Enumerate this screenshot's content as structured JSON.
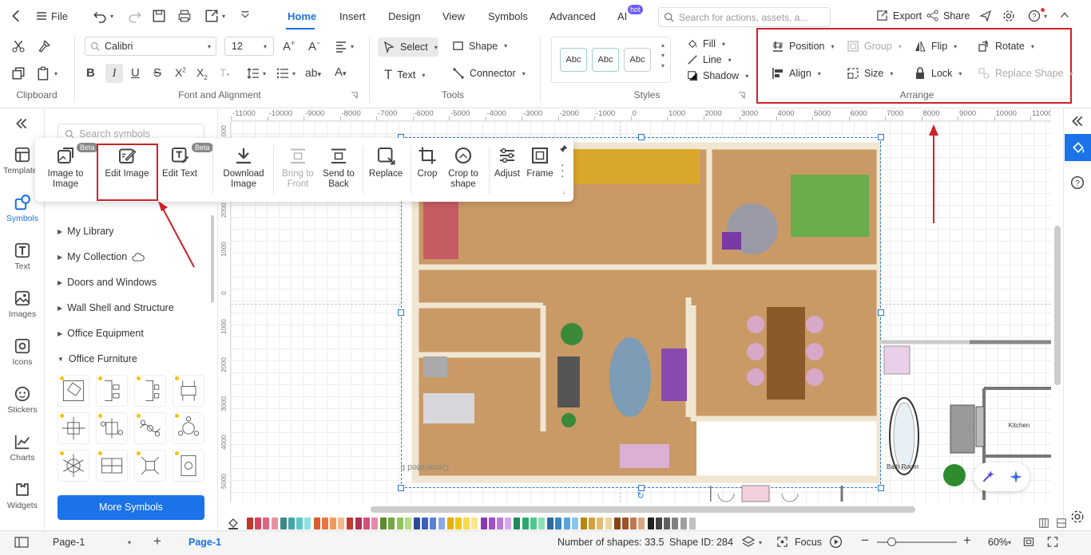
{
  "app": {
    "file_label": "File",
    "accent": "#1a73e8"
  },
  "menu_tabs": [
    "Home",
    "Insert",
    "Design",
    "View",
    "Symbols",
    "Advanced",
    "AI"
  ],
  "ai_badge": "hot",
  "search": {
    "placeholder": "Search for actions, assets, a..."
  },
  "header_actions": {
    "export": "Export",
    "share": "Share"
  },
  "ribbon": {
    "font_name": "Calibri",
    "font_size": "12",
    "select": "Select",
    "shape": "Shape",
    "text": "Text",
    "connector": "Connector",
    "style_sample": "Abc",
    "fill": "Fill",
    "line": "Line",
    "shadow": "Shadow",
    "position": "Position",
    "group": "Group",
    "flip": "Flip",
    "rotate": "Rotate",
    "align": "Align",
    "size": "Size",
    "lock": "Lock",
    "replace_shape": "Replace Shape",
    "sections": {
      "clipboard": "Clipboard",
      "font_alignment": "Font and Alignment",
      "tools": "Tools",
      "styles": "Styles",
      "arrange": "Arrange"
    }
  },
  "ruler_h": [
    "-11000",
    "-10000",
    "-9000",
    "-8000",
    "-7000",
    "-6000",
    "-5000",
    "-4000",
    "-3000",
    "-2000",
    "-1000",
    "0",
    "1000",
    "2000",
    "3000",
    "4000",
    "5000",
    "6000",
    "7000",
    "8000",
    "9000",
    "10000",
    "11000"
  ],
  "ruler_v": [
    "1000",
    "3000",
    "2000",
    "1000",
    "0",
    "1000",
    "2000",
    "3000",
    "4000",
    "5000"
  ],
  "left_sidebar": [
    {
      "label": "Templates",
      "icon": "template-icon"
    },
    {
      "label": "Symbols",
      "icon": "symbols-icon"
    },
    {
      "label": "Text",
      "icon": "text-icon"
    },
    {
      "label": "Images",
      "icon": "image-icon"
    },
    {
      "label": "Icons",
      "icon": "icons-icon"
    },
    {
      "label": "Stickers",
      "icon": "sticker-icon"
    },
    {
      "label": "Charts",
      "icon": "chart-icon"
    },
    {
      "label": "Widgets",
      "icon": "widget-icon"
    }
  ],
  "symbols_panel": {
    "search_placeholder": "Search symbols",
    "libraries": [
      "My Library",
      "My Collection",
      "Doors and Windows",
      "Wall Shell and Structure",
      "Office Equipment",
      "Office Furniture"
    ],
    "more_button": "More Symbols"
  },
  "image_toolbar": {
    "beta_badge": "Beta",
    "buttons": [
      {
        "label": "Image to Image",
        "disabled": false
      },
      {
        "label": "Edit Image",
        "disabled": false
      },
      {
        "label": "Edit Text",
        "disabled": false
      },
      {
        "label": "Download Image",
        "disabled": false
      },
      {
        "label": "Bring to Front",
        "disabled": true
      },
      {
        "label": "Send to Back",
        "disabled": false
      },
      {
        "label": "Replace",
        "disabled": false
      },
      {
        "label": "Crop",
        "disabled": false
      },
      {
        "label": "Crop to shape",
        "disabled": false
      },
      {
        "label": "Adjust",
        "disabled": false
      },
      {
        "label": "Frame",
        "disabled": false
      }
    ]
  },
  "canvas": {
    "watermark": "Generated by AI",
    "right_plan_labels": {
      "kitchen": "Kitchen",
      "bath": "Bath Room"
    }
  },
  "status_bar": {
    "page_selector": "Page-1",
    "active_page": "Page-1",
    "shape_count": "Number of shapes: 33.5",
    "shape_id": "Shape ID: 284",
    "focus": "Focus",
    "zoom": "60%"
  },
  "palette": [
    "#c0392b",
    "#d64560",
    "#e06680",
    "#e8909c",
    "#3b8a8a",
    "#45a5a5",
    "#5cc8c8",
    "#8fe0e0",
    "#e05a2b",
    "#e9773d",
    "#f29a5b",
    "#f7b888",
    "#c0392b",
    "#b03050",
    "#d0507a",
    "#e58aa8",
    "#5a8a2b",
    "#72a83d",
    "#8fc45b",
    "#b3dc88",
    "#2b4a9a",
    "#3a5fbd",
    "#5a80d6",
    "#8aa8e8",
    "#e6b000",
    "#f2c500",
    "#f7d94a",
    "#fae78a",
    "#8a3ab0",
    "#a04fc8",
    "#bd78dc",
    "#d8a8ec",
    "#1f8a5a",
    "#28a870",
    "#52c890",
    "#8ae0b8",
    "#2b6aa0",
    "#3a85c0",
    "#5aa5dc",
    "#8ac5ec",
    "#b8860b",
    "#d0a040",
    "#e0bc70",
    "#ecd4a0",
    "#8b4513",
    "#a0522d",
    "#c07850",
    "#d8a880",
    "#202020",
    "#404040",
    "#606060",
    "#808080",
    "#a0a0a0",
    "#c0c0c0"
  ]
}
